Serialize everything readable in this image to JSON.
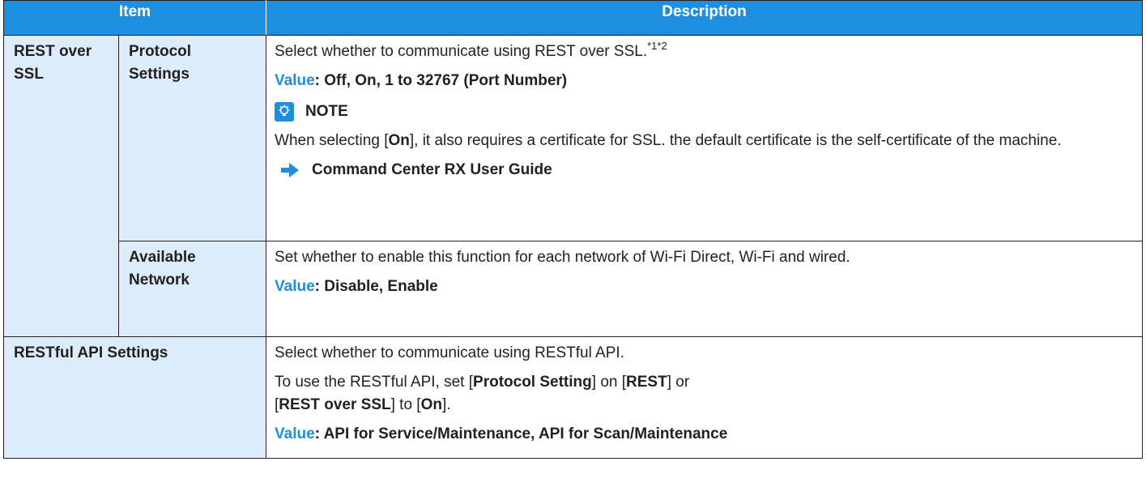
{
  "header": {
    "item": "Item",
    "description": "Description"
  },
  "colors": {
    "header_bg": "#1e8fe0",
    "cell_bg": "#dcecfa",
    "accent": "#1e8fe0"
  },
  "rows": {
    "rest_over_ssl": {
      "label": "REST over SSL",
      "protocol": {
        "label": "Protocol Settings",
        "text": "Select whether to communicate using REST over SSL.",
        "sup": "*1*2",
        "value_key": "Value",
        "value": ": Off, On, 1 to 32767 (Port Number)",
        "note_icon": "lightbulb-icon",
        "note_label": "NOTE",
        "note_pre": "When selecting [",
        "note_bold": "On",
        "note_post": "], it also requires a certificate for SSL. the default certificate is the self-certificate of the machine.",
        "ref_icon": "arrow-right-icon",
        "ref": "Command Center RX User Guide"
      },
      "available": {
        "label": "Available Network",
        "text": "Set whether to enable this function for each network of Wi-Fi Direct, Wi-Fi and wired.",
        "value_key": "Value",
        "value": ": Disable, Enable"
      }
    },
    "restful_api": {
      "label": "RESTful API Settings",
      "text1": "Select whether to communicate using RESTful API.",
      "t2a": "To use the RESTful API, set [",
      "t2b": "Protocol Setting",
      "t2c": "] on [",
      "t2d": "REST",
      "t2e": "] or",
      "t3a": "[",
      "t3b": "REST over SSL",
      "t3c": "] to [",
      "t3d": "On",
      "t3e": "].",
      "value_key": "Value",
      "value": ": API for Service/Maintenance, API for Scan/Maintenance"
    }
  }
}
